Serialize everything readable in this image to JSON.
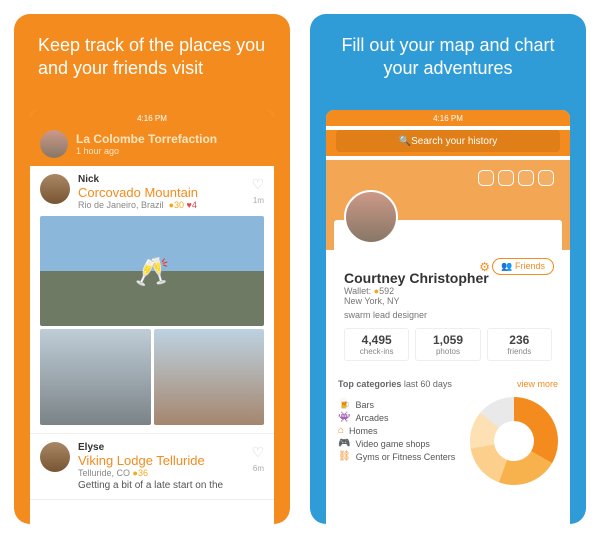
{
  "left": {
    "headline": "Keep track of the places you and your friends visit",
    "status_time": "4:16 PM",
    "self_checkin": {
      "venue": "La Colombe Torrefaction",
      "sub": "1 hour ago"
    },
    "items": [
      {
        "name": "Nick",
        "venue": "Corcovado Mountain",
        "location": "Rio de Janeiro, Brazil",
        "coins": "30",
        "hearts": "4",
        "timestamp": "1m"
      },
      {
        "name": "Elyse",
        "venue": "Viking Lodge Telluride",
        "location": "Telluride, CO",
        "coins": "36",
        "timestamp": "6m",
        "body": "Getting a bit of a late start on the"
      }
    ]
  },
  "right": {
    "headline": "Fill out your map and chart your adventures",
    "status_time": "4:16 PM",
    "search_placeholder": "Search your history",
    "friends_button": "Friends",
    "profile": {
      "name": "Courtney Christopher",
      "wallet_label": "Wallet:",
      "wallet_value": "592",
      "location": "New York, NY",
      "bio": "swarm lead designer"
    },
    "stats": [
      {
        "n": "4,495",
        "l": "check-ins"
      },
      {
        "n": "1,059",
        "l": "photos"
      },
      {
        "n": "236",
        "l": "friends"
      }
    ],
    "top_categories": {
      "label": "Top categories",
      "period": "last 60 days",
      "view_more": "view more"
    },
    "categories": [
      "Bars",
      "Arcades",
      "Homes",
      "Video game shops",
      "Gyms or Fitness Centers"
    ]
  },
  "chart_data": {
    "type": "pie",
    "title": "Top categories last 60 days",
    "categories": [
      "Bars",
      "Arcades",
      "Homes",
      "Video game shops",
      "Gyms or Fitness Centers"
    ],
    "values": [
      33,
      22,
      17,
      14,
      14
    ]
  }
}
